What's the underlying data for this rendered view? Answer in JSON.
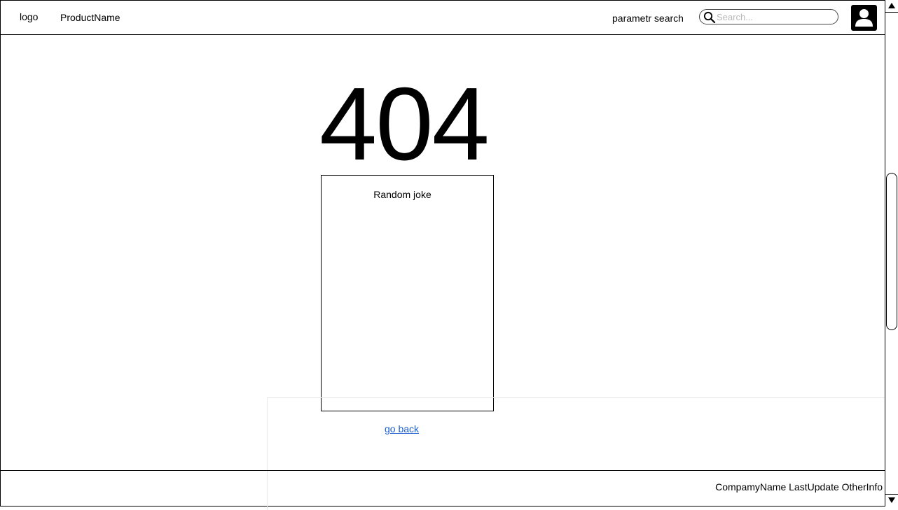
{
  "header": {
    "logo_label": "logo",
    "product_name": "ProductName",
    "param_search_label": "parametr search",
    "search": {
      "placeholder": "Search...",
      "value": ""
    },
    "search_icon": "magnifier-icon",
    "avatar_icon": "user-avatar-icon"
  },
  "main": {
    "error_code": "404",
    "joke_title": "Random joke",
    "go_back_label": "go back"
  },
  "footer": {
    "info": "CompamyName LastUpdate OtherInfo"
  },
  "colors": {
    "link": "#1a5fd0",
    "placeholder": "#b8b8b8",
    "border": "#000000"
  }
}
